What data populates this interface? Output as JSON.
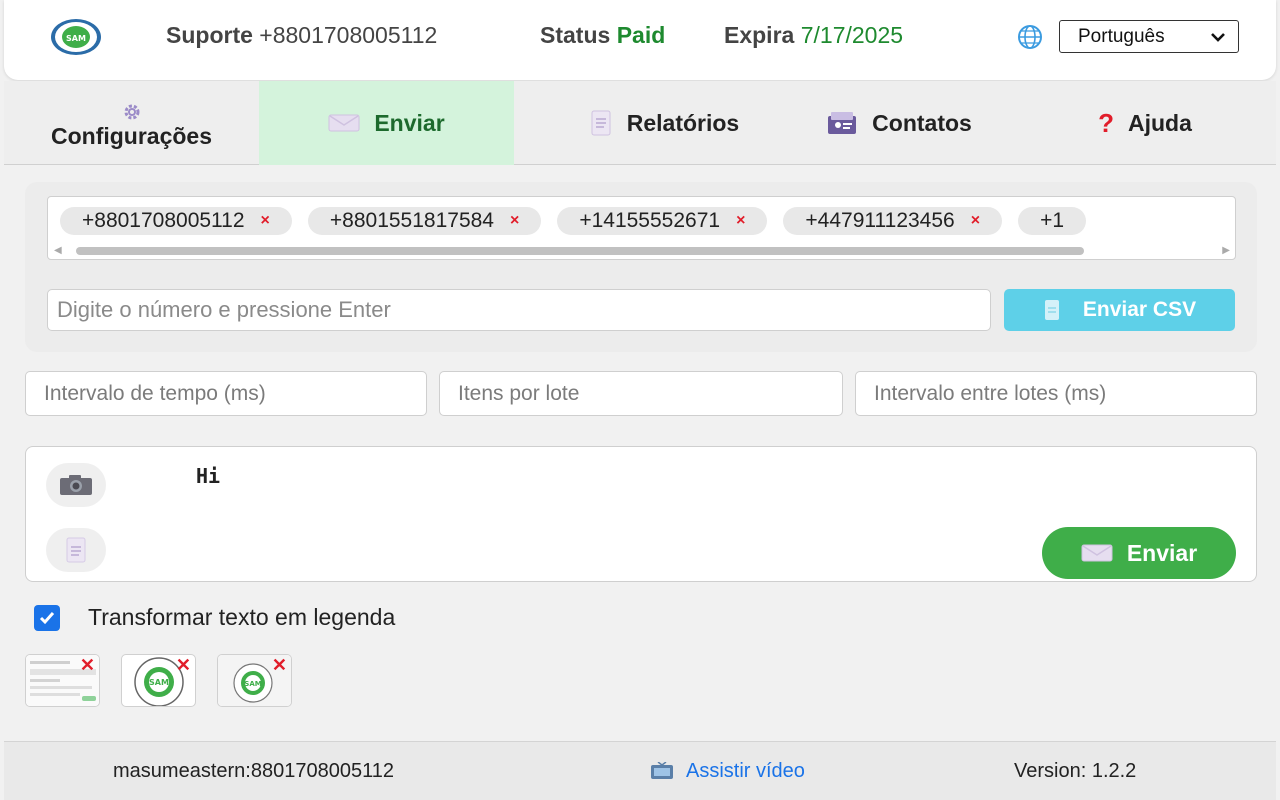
{
  "header": {
    "support_label": "Suporte",
    "support_number": "+8801708005112",
    "status_label": "Status",
    "status_value": "Paid",
    "expires_label": "Expira",
    "expires_value": "7/17/2025",
    "language": "Português",
    "logo_text": "SAM"
  },
  "tabs": [
    {
      "label": "Configurações",
      "icon": "gear-icon"
    },
    {
      "label": "Enviar",
      "icon": "envelope-icon",
      "active": true
    },
    {
      "label": "Relatórios",
      "icon": "document-icon"
    },
    {
      "label": "Contatos",
      "icon": "contacts-icon"
    },
    {
      "label": "Ajuda",
      "icon": "question-icon"
    }
  ],
  "numbers": {
    "chips": [
      "+8801708005112",
      "+8801551817584",
      "+14155552671",
      "+447911123456",
      "+1"
    ],
    "remove_glyph": "×",
    "input_placeholder": "Digite o número e pressione Enter",
    "csv_button": "Enviar CSV"
  },
  "settings": {
    "interval_placeholder": "Intervalo de tempo (ms)",
    "batch_placeholder": "Itens por lote",
    "batch_interval_placeholder": "Intervalo entre lotes (ms)"
  },
  "message": {
    "text": "Hi",
    "send_button": "Enviar"
  },
  "caption": {
    "label": "Transformar texto em legenda",
    "checked": true
  },
  "attachments": [
    {
      "type": "screenshot"
    },
    {
      "type": "logo"
    },
    {
      "type": "logo"
    }
  ],
  "footer": {
    "account": "masumeastern:8801708005112",
    "video_link": "Assistir vídeo",
    "version": "Version: 1.2.2"
  },
  "colors": {
    "accent_green": "#3fae49",
    "status_green": "#1e8a2f",
    "csv_cyan": "#5ed0e8",
    "link_blue": "#1a73e8",
    "remove_red": "#e11d2a"
  }
}
